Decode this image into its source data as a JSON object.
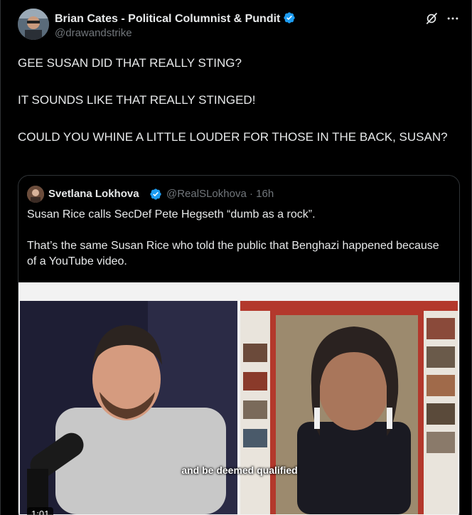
{
  "tweet": {
    "author_name": "Brian Cates - Political Columnist & Pundit",
    "author_handle": "@drawandstrike",
    "lines": [
      "GEE SUSAN DID THAT REALLY STING?",
      "IT SOUNDS LIKE THAT REALLY STINGED!",
      "COULD YOU WHINE A LITTLE LOUDER FOR THOSE IN THE BACK, SUSAN?"
    ]
  },
  "quote": {
    "author_name": "Svetlana Lokhova",
    "author_handle": "@RealSLokhova",
    "separator": "·",
    "time": "16h",
    "paragraphs": [
      "Susan Rice calls SecDef Pete Hegseth “dumb as a rock”.",
      "That’s the same Susan Rice who told the public that Benghazi happened because of a YouTube video."
    ],
    "video": {
      "caption": "and be deemed qualified",
      "timestamp": "1:01"
    }
  },
  "icons": {
    "verified": "verified-badge-icon",
    "grok": "grok-icon",
    "more": "more-icon"
  },
  "colors": {
    "background": "#000000",
    "text": "#e7e9ea",
    "secondary_text": "#71767b",
    "verified_blue": "#1d9bf0",
    "border": "#2f3336"
  }
}
